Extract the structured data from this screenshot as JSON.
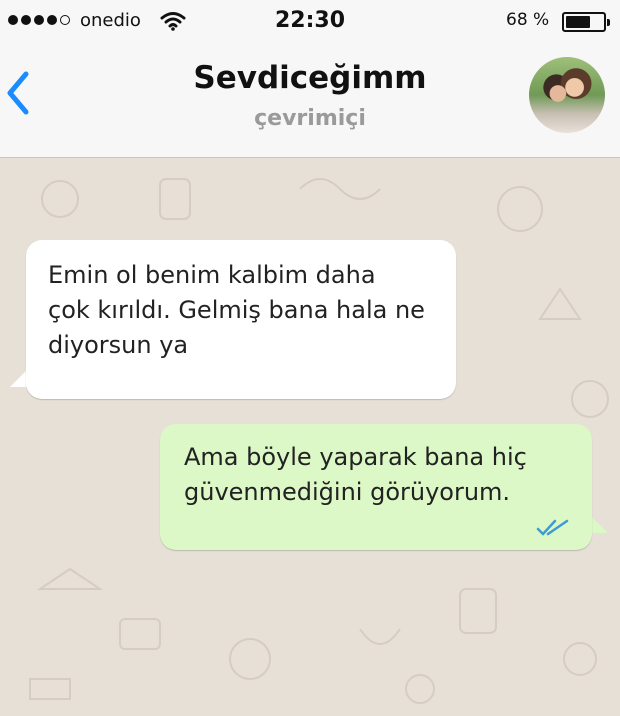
{
  "status_bar": {
    "carrier": "onedio",
    "time": "22:30",
    "battery_percent": "68 %",
    "battery_level": 0.68,
    "signal_bars_filled": 4,
    "signal_bars_total": 5
  },
  "header": {
    "contact_name": "Sevdiceğimm",
    "contact_status": "çevrimiçi",
    "back_icon": "chevron-left-icon",
    "accent_color": "#1a8cff"
  },
  "messages": [
    {
      "direction": "incoming",
      "lines": [
        "Emin ol benim kalbim daha",
        "çok kırıldı. Gelmiş bana hala ne",
        "diyorsun ya"
      ]
    },
    {
      "direction": "outgoing",
      "lines": [
        "Ama böyle yaparak bana hiç",
        "güvenmediğini görüyorum."
      ],
      "status_icon": "double-check-icon"
    }
  ],
  "colors": {
    "incoming_bubble": "#ffffff",
    "outgoing_bubble": "#dcf8c6",
    "chat_background": "#e7e0d6",
    "read_ticks": "#3f9bd1"
  }
}
